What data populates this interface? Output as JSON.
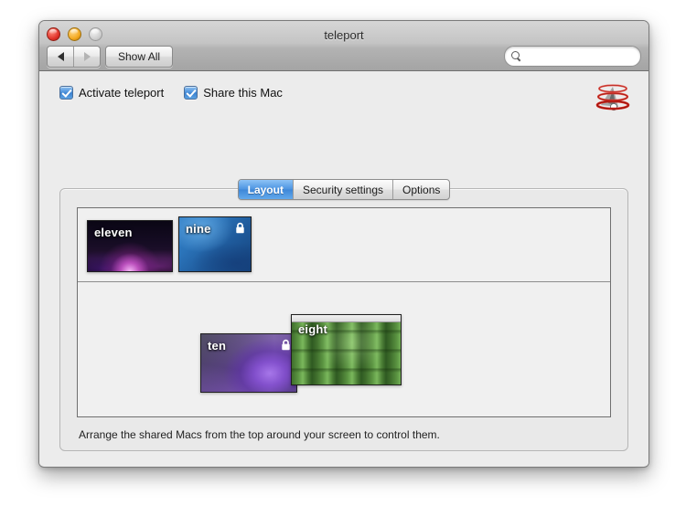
{
  "window": {
    "title": "teleport",
    "traffic_lights": [
      "close",
      "minimize",
      "zoom"
    ]
  },
  "toolbar": {
    "back_icon": "back-arrow-icon",
    "forward_icon": "forward-arrow-icon",
    "show_all_label": "Show All",
    "search_value": "",
    "search_placeholder": ""
  },
  "options": {
    "activate_label": "Activate teleport",
    "activate_checked": true,
    "share_label": "Share this Mac",
    "share_checked": true,
    "logo_icon": "teleport-logo-icon"
  },
  "tabs": [
    {
      "label": "Layout",
      "active": true
    },
    {
      "label": "Security settings",
      "active": false
    },
    {
      "label": "Options",
      "active": false
    }
  ],
  "layout": {
    "caption": "Arrange the shared Macs from the top around your screen to control them.",
    "shelf_macs": [
      {
        "name": "eleven",
        "locked": false,
        "wallpaper": "aurora-pink",
        "is_local": false
      },
      {
        "name": "nine",
        "locked": true,
        "wallpaper": "blue-aurora",
        "is_local": false
      }
    ],
    "placed_macs": [
      {
        "name": "ten",
        "locked": true,
        "wallpaper": "purple-flower",
        "is_local": false
      },
      {
        "name": "eight",
        "locked": false,
        "wallpaper": "bamboo",
        "is_local": true
      }
    ]
  },
  "colors": {
    "accent_blue": "#4d95e2",
    "window_bg": "#ececec",
    "panel_bg": "#f0f0f0",
    "logo_red": "#d42a22"
  }
}
